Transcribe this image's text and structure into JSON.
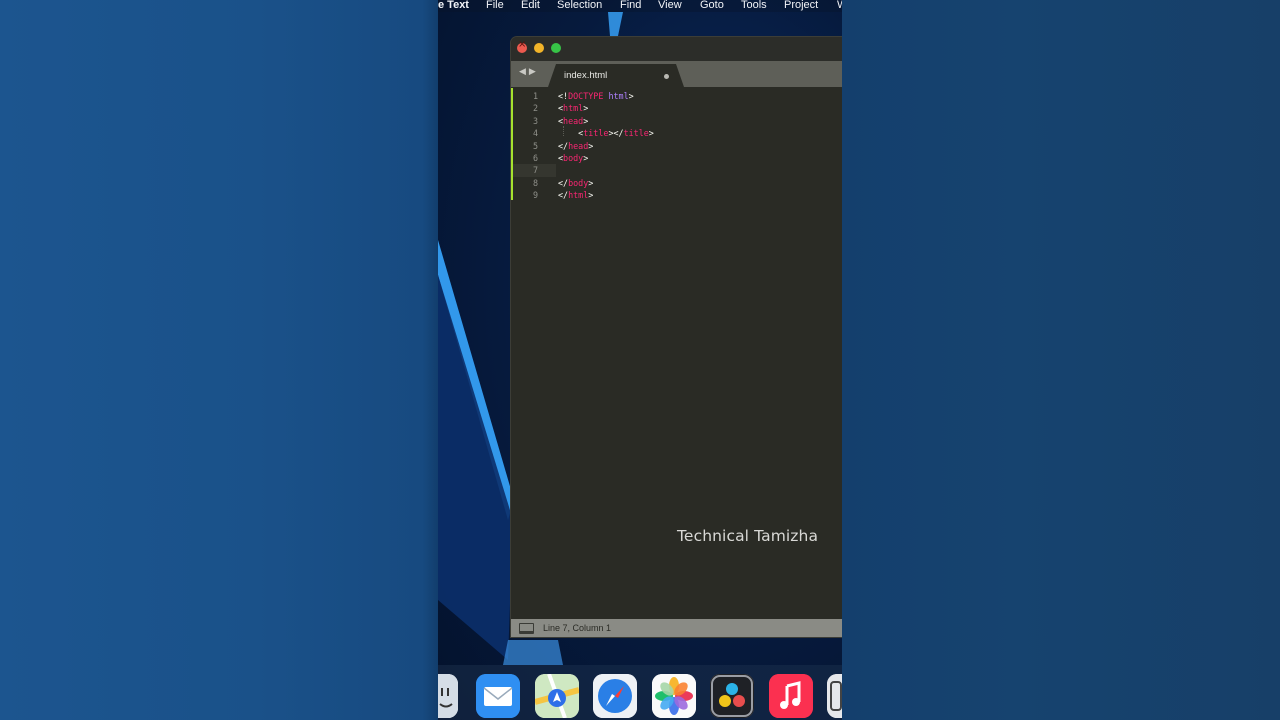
{
  "menubar": {
    "app_name": "e Text",
    "items": [
      "File",
      "Edit",
      "Selection",
      "Find",
      "View",
      "Goto",
      "Tools",
      "Project",
      "W"
    ]
  },
  "editor": {
    "tab_label": "index.html",
    "lines": [
      {
        "number": "1",
        "parts": [
          [
            "plain",
            "<!"
          ],
          [
            "kw",
            "DOCTYPE"
          ],
          [
            "plain",
            " "
          ],
          [
            "attr",
            "html"
          ],
          [
            "plain",
            ">"
          ]
        ]
      },
      {
        "number": "2",
        "parts": [
          [
            "plain",
            "<"
          ],
          [
            "tag",
            "html"
          ],
          [
            "plain",
            ">"
          ]
        ]
      },
      {
        "number": "3",
        "parts": [
          [
            "plain",
            "<"
          ],
          [
            "tag",
            "head"
          ],
          [
            "plain",
            ">"
          ]
        ]
      },
      {
        "number": "4",
        "parts": [
          [
            "plain",
            "    <"
          ],
          [
            "tag",
            "title"
          ],
          [
            "plain",
            "></"
          ],
          [
            "tag",
            "title"
          ],
          [
            "plain",
            ">"
          ]
        ]
      },
      {
        "number": "5",
        "parts": [
          [
            "plain",
            "</"
          ],
          [
            "tag",
            "head"
          ],
          [
            "plain",
            ">"
          ]
        ]
      },
      {
        "number": "6",
        "parts": [
          [
            "plain",
            "<"
          ],
          [
            "tag",
            "body"
          ],
          [
            "plain",
            ">"
          ]
        ]
      },
      {
        "number": "7",
        "parts": []
      },
      {
        "number": "8",
        "parts": [
          [
            "plain",
            "</"
          ],
          [
            "tag",
            "body"
          ],
          [
            "plain",
            ">"
          ]
        ]
      },
      {
        "number": "9",
        "parts": [
          [
            "plain",
            "</"
          ],
          [
            "tag",
            "html"
          ],
          [
            "plain",
            ">"
          ]
        ]
      }
    ],
    "current_line": 7,
    "watermark": "Technical Tamizha",
    "status_text": "Line 7, Column 1"
  },
  "dock": {
    "apps": [
      "finder-icon",
      "mail-icon",
      "maps-icon",
      "safari-icon",
      "photos-icon",
      "davinci-resolve-icon",
      "music-icon",
      "partial-app-icon"
    ]
  },
  "colors": {
    "editor_bg": "#2a2b25",
    "keyword": "#f92672",
    "attribute": "#ae81ff",
    "line_number": "#8f908a",
    "modified_bar": "#a6e22e"
  }
}
